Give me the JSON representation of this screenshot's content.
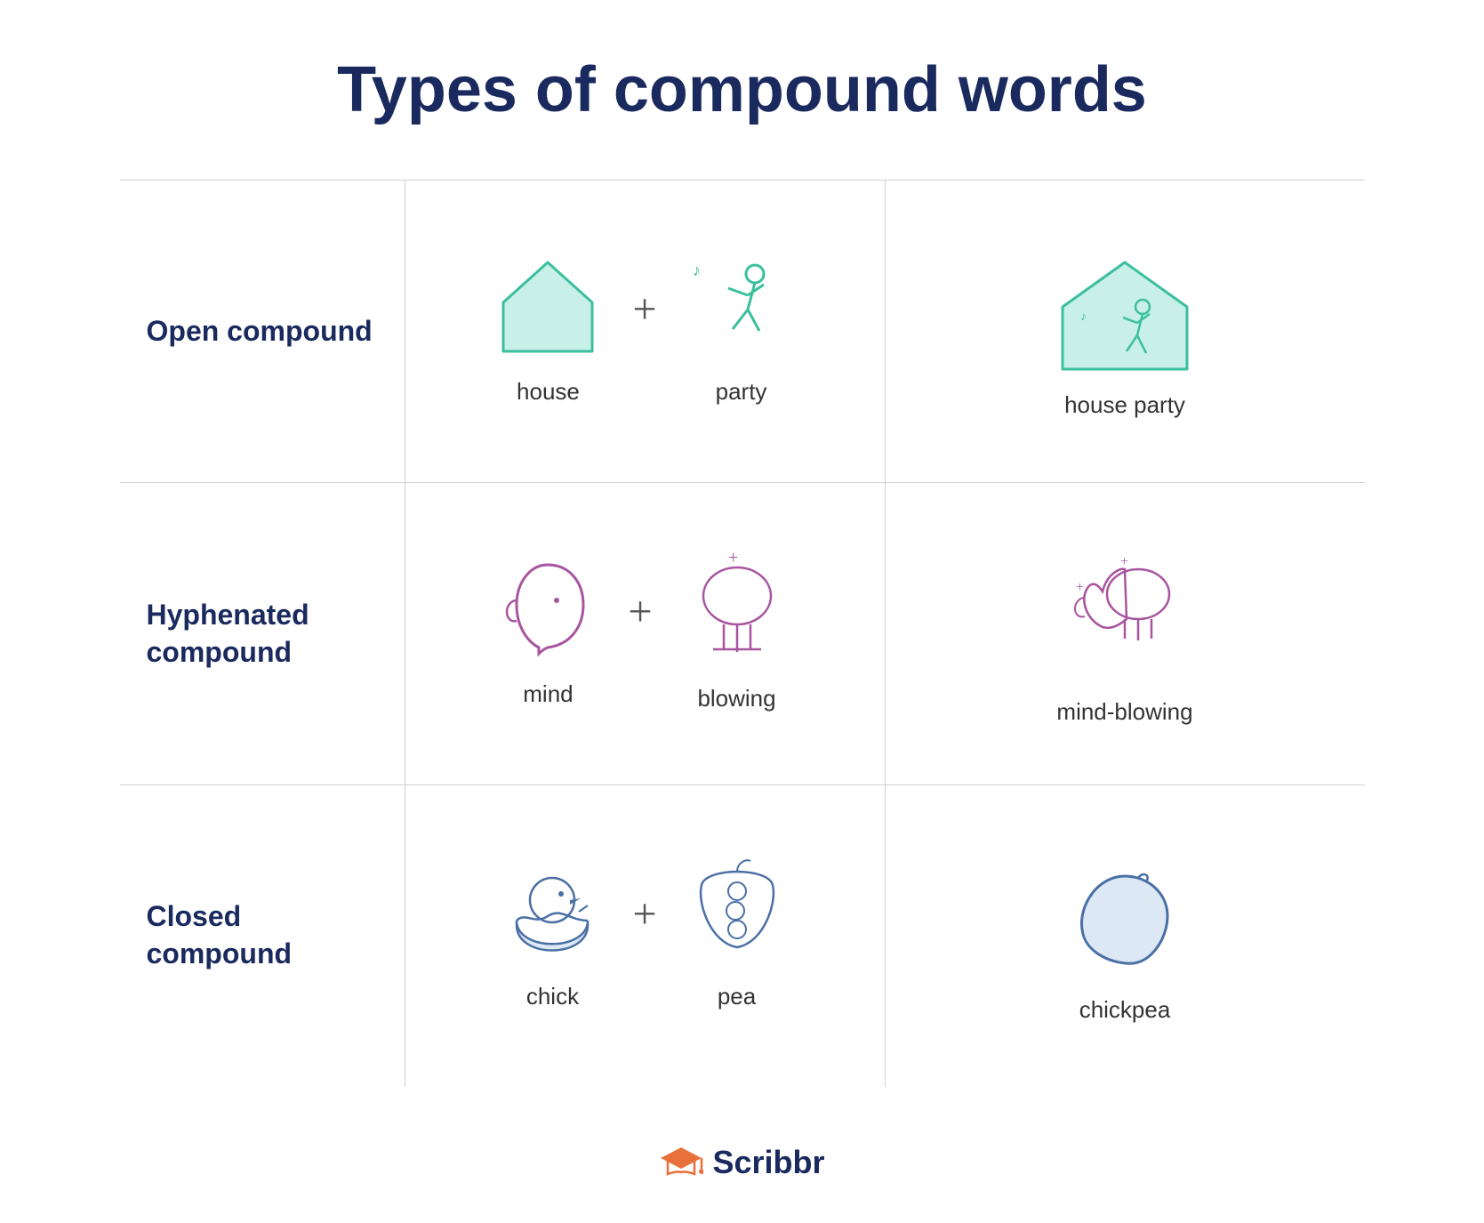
{
  "title": "Types of compound words",
  "rows": [
    {
      "label": "Open compound",
      "word1": "house",
      "word2": "party",
      "combined": "house party",
      "type": "open"
    },
    {
      "label": "Hyphenated compound",
      "word1": "mind",
      "word2": "blowing",
      "combined": "mind-blowing",
      "type": "hyphenated"
    },
    {
      "label": "Closed compound",
      "word1": "chick",
      "word2": "pea",
      "combined": "chickpea",
      "type": "closed"
    }
  ],
  "footer": {
    "brand": "Scribbr"
  }
}
